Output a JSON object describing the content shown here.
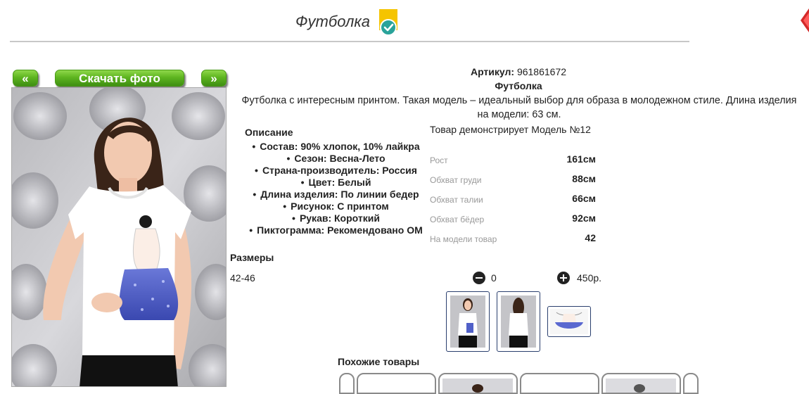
{
  "header": {
    "title": "Футболка"
  },
  "photo_nav": {
    "prev_label": "«",
    "download_label": "Скачать фото",
    "next_label": "»"
  },
  "product": {
    "article_label": "Артикул:",
    "article_value": "961861672",
    "name": "Футболка",
    "description": "Футболка с интересным принтом. Такая модель – идеальный выбор для образа в молодежном стиле. Длина изделия на модели: 63 см."
  },
  "specs": {
    "heading": "Описание",
    "items": [
      "Состав: 90% хлопок, 10% лайкра",
      "Сезон: Весна-Лето",
      "Страна-производитель: Россия",
      "Цвет: Белый",
      "Длина изделия: По линии бедер",
      "Рисунок: С принтом",
      "Рукав: Короткий",
      "Пиктограмма: Рекомендовано ОМ"
    ]
  },
  "model": {
    "heading": "Товар демонстрирует Модель №12",
    "rows": [
      {
        "label": "Рост",
        "value": "161см"
      },
      {
        "label": "Обхват груди",
        "value": "88см"
      },
      {
        "label": "Обхват талии",
        "value": "66см"
      },
      {
        "label": "Обхват бёдер",
        "value": "92см"
      },
      {
        "label": "На модели товар",
        "value": "42"
      }
    ]
  },
  "sizes": {
    "heading": "Размеры",
    "size": "42-46",
    "quantity": "0",
    "price": "450р."
  },
  "similar": {
    "heading": "Похожие товары"
  },
  "colors": {
    "accent_green": "#5eb520",
    "badge_yellow": "#f5c400",
    "badge_check": "#2aa39a",
    "corner_red": "#d42a2a",
    "thumb_border": "#2a3f6e"
  },
  "icons": [
    "check-badge-icon",
    "minus-icon",
    "plus-icon"
  ]
}
